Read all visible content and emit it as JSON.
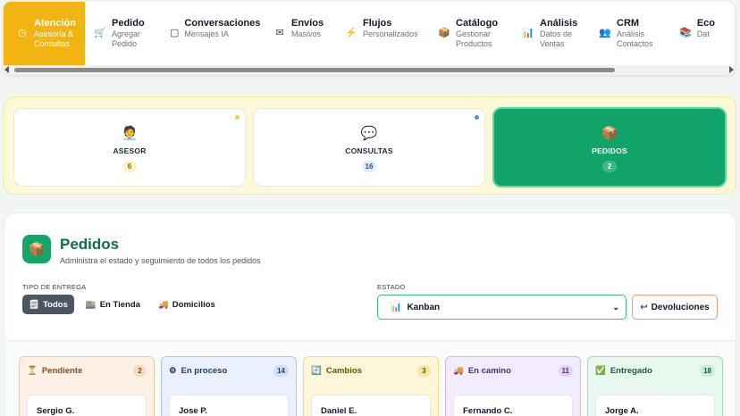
{
  "nav": {
    "items": [
      {
        "title": "Atención",
        "sub1": "Asesoría &",
        "sub2": "Consultas",
        "icon": "◷",
        "icon_name": "clock-icon"
      },
      {
        "title": "Pedido",
        "sub1": "Agregar",
        "sub2": "Pedido",
        "icon": "🛒",
        "icon_name": "cart-icon"
      },
      {
        "title": "Conversaciones",
        "sub1": "Mensajes IA",
        "sub2": "",
        "icon": "▢",
        "icon_name": "chat-icon"
      },
      {
        "title": "Envíos",
        "sub1": "Masivos",
        "sub2": "",
        "icon": "✉",
        "icon_name": "mail-icon"
      },
      {
        "title": "Flujos",
        "sub1": "Personalizados",
        "sub2": "",
        "icon": "⚡",
        "icon_name": "lightning-icon"
      },
      {
        "title": "Catálogo",
        "sub1": "Gestionar",
        "sub2": "Productos",
        "icon": "📦",
        "icon_name": "box-icon"
      },
      {
        "title": "Análisis",
        "sub1": "Datos de",
        "sub2": "Ventas",
        "icon": "📊",
        "icon_name": "chart-icon"
      },
      {
        "title": "CRM",
        "sub1": "Análisis",
        "sub2": "Contactos",
        "icon": "👥",
        "icon_name": "users-icon"
      },
      {
        "title": "Eco",
        "sub1": "Dat",
        "sub2": "",
        "icon": "📚",
        "icon_name": "books-icon"
      }
    ]
  },
  "categories": [
    {
      "label": "ASESOR",
      "count": "6",
      "icon": "🧑‍💼",
      "icon_name": "advisor-icon",
      "count_bg": "#fdf3c4",
      "count_color": "#8a6d00",
      "dot": "#f2c94c"
    },
    {
      "label": "CONSULTAS",
      "count": "16",
      "icon": "💬",
      "icon_name": "speech-bubble-icon",
      "count_bg": "#e3ecfb",
      "count_color": "#2b4f8a",
      "dot": "#4a90e2"
    },
    {
      "label": "PEDIDOS",
      "count": "2",
      "icon": "📦",
      "icon_name": "box-icon",
      "count_bg": "#3eb884",
      "count_color": "#ffffff",
      "dot": ""
    }
  ],
  "panel": {
    "icon": "📦",
    "title": "Pedidos",
    "subtitle": "Administra el estado y seguimiento de todos los pedidos",
    "delivery_label": "TIPO DE ENTREGA",
    "delivery_options": [
      {
        "label": "Todos",
        "icon": "🗒"
      },
      {
        "label": "En Tienda",
        "icon": "🏬"
      },
      {
        "label": "Domicilios",
        "icon": "🚚"
      }
    ],
    "state_label": "ESTADO",
    "state_value": "Kanban",
    "state_icon": "📊",
    "returns_label": "Devoluciones",
    "returns_icon": "↩"
  },
  "columns": [
    {
      "name": "Pendiente",
      "count": "2",
      "icon": "⏳",
      "bg": "#fdf0e4",
      "border": "#f4c89e",
      "color": "#8a4a14",
      "count_bg": "#f9dcc0",
      "card": "Sergio G."
    },
    {
      "name": "En proceso",
      "count": "14",
      "icon": "⚙",
      "bg": "#eaf1fc",
      "border": "#a9c6ee",
      "color": "#1e3a6e",
      "count_bg": "#cfdff7",
      "card": "Jose P."
    },
    {
      "name": "Cambios",
      "count": "3",
      "icon": "🔄",
      "bg": "#fdf6d8",
      "border": "#efd98a",
      "color": "#6b5300",
      "count_bg": "#f5e6a6",
      "card": "Daniel E."
    },
    {
      "name": "En camino",
      "count": "11",
      "icon": "🚚",
      "bg": "#f3ecfc",
      "border": "#cfb8ef",
      "color": "#4a2a7a",
      "count_bg": "#e2d3f7",
      "card": "Fernando C."
    },
    {
      "name": "Entregado",
      "count": "18",
      "icon": "✅",
      "bg": "#e8f8ef",
      "border": "#9fdcbc",
      "color": "#155c38",
      "count_bg": "#c9eed9",
      "card": "Jorge A."
    }
  ]
}
